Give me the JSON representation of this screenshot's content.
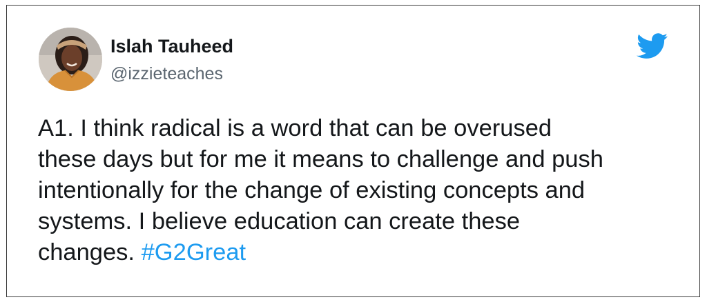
{
  "tweet": {
    "author_name": "Islah Tauheed",
    "handle": "@izzieteaches",
    "text_lines": [
      "A1. I think radical is a word that can be overused",
      "these days but for me it means to challenge and push",
      "intentionally for the change of existing concepts and",
      "systems. I believe education can create these",
      "changes. "
    ],
    "hashtag": "#G2Great"
  },
  "icons": {
    "brand": "twitter-bird-icon",
    "avatar": "profile-photo"
  },
  "colors": {
    "brand_blue": "#1d9bf0",
    "text": "#14171a",
    "handle_gray": "#5b6670",
    "border": "#3a3a3a"
  }
}
